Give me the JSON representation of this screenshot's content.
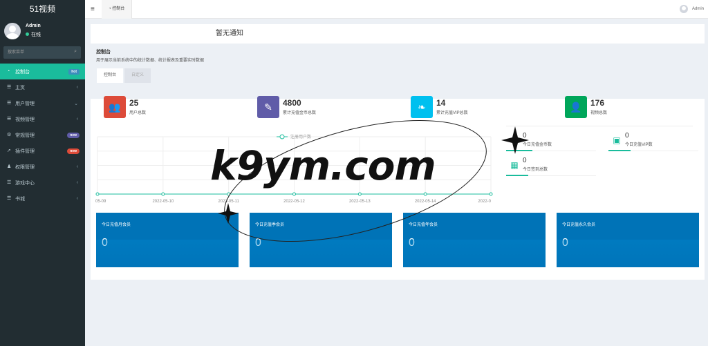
{
  "brand": {
    "title": "51视频"
  },
  "user": {
    "name": "Admin",
    "status": "在线"
  },
  "search": {
    "placeholder": "搜索菜单"
  },
  "menu": [
    {
      "label": "控制台",
      "icon": "dashboard-icon",
      "badge": "hot",
      "badge_color": "#3c8dbc",
      "active": true
    },
    {
      "label": "主页",
      "icon": "list-icon",
      "chevron": "‹"
    },
    {
      "label": "用户管理",
      "icon": "list-icon",
      "chevron": "⌄"
    },
    {
      "label": "视频管理",
      "icon": "list-icon",
      "chevron": "‹"
    },
    {
      "label": "常规管理",
      "icon": "gears-icon",
      "badge": "new",
      "badge_color": "#605ca8"
    },
    {
      "label": "插件管理",
      "icon": "rocket-icon",
      "badge": "new",
      "badge_color": "#dd4b39"
    },
    {
      "label": "权限管理",
      "icon": "group-icon",
      "chevron": "‹"
    },
    {
      "label": "游戏中心",
      "icon": "list-icon",
      "chevron": "‹"
    },
    {
      "label": "书城",
      "icon": "list-icon",
      "chevron": "‹"
    }
  ],
  "topbar": {
    "tab_label": "控制台",
    "user_name": "Admin"
  },
  "notice": "暂无通知",
  "header": {
    "title": "控制台",
    "description": "用于展示当前系统中的统计数据、统计报表及重要实时数据"
  },
  "tabs": [
    {
      "label": "控制台"
    },
    {
      "label": "自定义"
    }
  ],
  "stats": [
    {
      "value": "25",
      "label": "用户总数",
      "color": "#dd4b39",
      "icon": "users-icon"
    },
    {
      "value": "4800",
      "label": "累计充值金币总数",
      "color": "#605ca8",
      "icon": "magic-icon"
    },
    {
      "value": "14",
      "label": "累计充值VIP总数",
      "color": "#00c0ef",
      "icon": "leaf-icon"
    },
    {
      "value": "176",
      "label": "视频总数",
      "color": "#00a65a",
      "icon": "user-icon"
    }
  ],
  "side_stats": [
    {
      "value": "0",
      "label": "今日充值金币数",
      "icon": "coin-icon"
    },
    {
      "value": "0",
      "label": "今日充值VIP数",
      "icon": "id-card-icon"
    },
    {
      "value": "0",
      "label": "今日签到总数",
      "icon": "calendar-icon"
    }
  ],
  "cards": [
    {
      "title": "今日充值月会员",
      "value": "0"
    },
    {
      "title": "今日充值季会员",
      "value": "0"
    },
    {
      "title": "今日充值年会员",
      "value": "0"
    },
    {
      "title": "今日充值永久会员",
      "value": "0"
    }
  ],
  "chart_data": {
    "type": "line",
    "title": "",
    "legend": [
      "注册用户数"
    ],
    "categories": [
      "05-09",
      "2022-05-10",
      "2022-05-11",
      "2022-05-12",
      "2022-05-13",
      "2022-05-14",
      "2022-0"
    ],
    "series": [
      {
        "name": "注册用户数",
        "values": [
          0,
          0,
          0,
          0,
          0,
          0,
          0
        ]
      }
    ],
    "line_color": "#1abc9c"
  },
  "watermark": "k9ym.com"
}
